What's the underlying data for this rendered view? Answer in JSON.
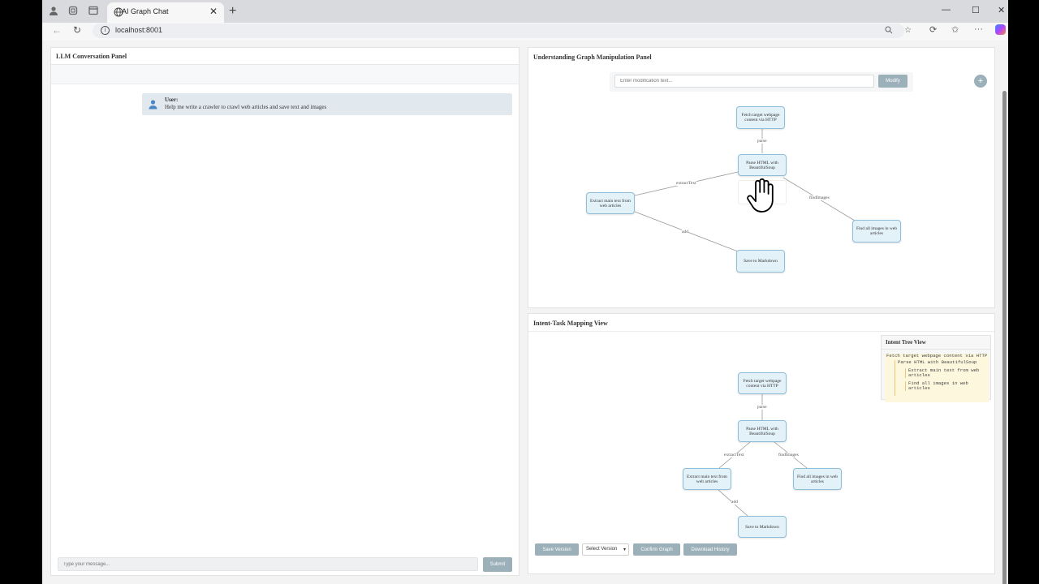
{
  "browser": {
    "tab_title": "AI Graph Chat",
    "tab_close": "✕",
    "new_tab": "+",
    "url": "localhost:8001",
    "window_controls": {
      "minimize": "—",
      "maximize": "☐",
      "close": "✕"
    }
  },
  "left_panel": {
    "title": "LLM Conversation Panel",
    "messages": [
      {
        "sender": "User:",
        "text": "Help me write a crawler to crawl web articles and save text and images"
      }
    ],
    "input_placeholder": "Type your message...",
    "submit_label": "Submit"
  },
  "graph_panel": {
    "title": "Understanding Graph Manipulation Panel",
    "modify_placeholder": "Enter modification text...",
    "modify_label": "Modify",
    "add_label": "+",
    "nodes": {
      "fetch": "Fetch target webpage content via HTTP",
      "parse": "Parse HTML with BeautifulSoup",
      "extract": "Extract main text from web articles",
      "images": "Find all images in web articles",
      "save": "Save to Markdown"
    },
    "edges": {
      "parse": "parse",
      "extractText": "extractText",
      "findImages": "findImages",
      "add": "add"
    }
  },
  "mapping_panel": {
    "title": "Intent-Task Mapping View",
    "intent_tree": {
      "title": "Intent Tree View",
      "root": "Fetch target webpage content via HTTP",
      "child": "Parse HTML with BeautifulSoup",
      "grandchildren": [
        "Extract main text from web articles",
        "Find all images in web articles"
      ]
    },
    "buttons": {
      "save_version": "Save Version",
      "select_version": "Select Version",
      "confirm_graph": "Confirm Graph",
      "download_history": "Download History"
    }
  },
  "colors": {
    "accent_button": "#9bb0b8",
    "node_fill": "#e3f1f9",
    "node_border": "#8fbfd8",
    "message_bg": "#e1e8ee"
  }
}
